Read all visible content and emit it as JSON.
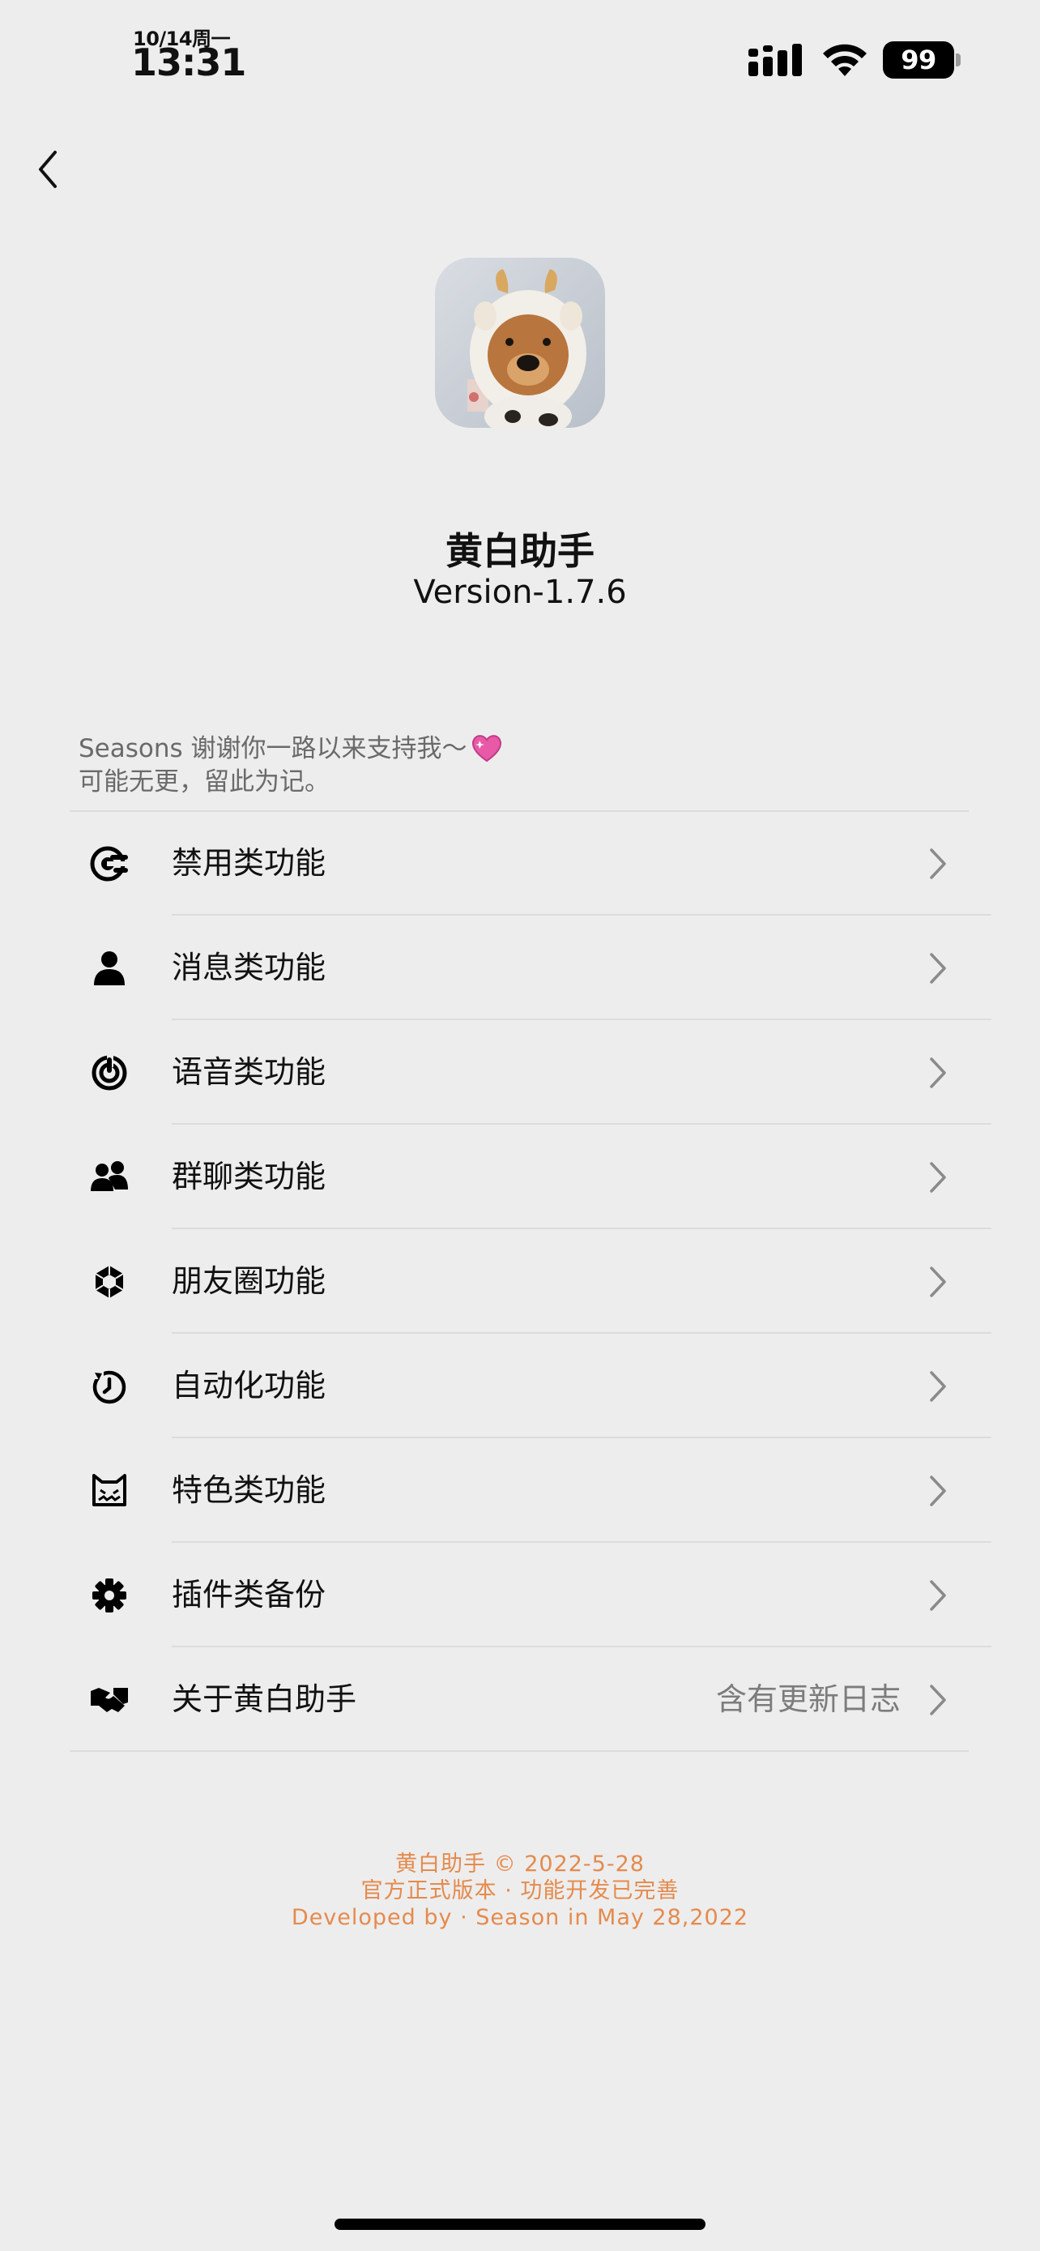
{
  "status_bar": {
    "date": "10/14周一",
    "time": "13:31",
    "battery": "99"
  },
  "header": {
    "app_name": "黄白助手",
    "version": "Version-1.7.6"
  },
  "note": {
    "line1": "Seasons 谢谢你一路以来支持我～",
    "line2": "可能无更，留此为记。"
  },
  "menu": {
    "items": [
      {
        "label": "禁用类功能",
        "icon": "block-icon"
      },
      {
        "label": "消息类功能",
        "icon": "person-icon"
      },
      {
        "label": "语音类功能",
        "icon": "voice-icon"
      },
      {
        "label": "群聊类功能",
        "icon": "group-icon"
      },
      {
        "label": "朋友圈功能",
        "icon": "moments-icon"
      },
      {
        "label": "自动化功能",
        "icon": "timer-icon"
      },
      {
        "label": "特色类功能",
        "icon": "cat-icon"
      },
      {
        "label": "插件类备份",
        "icon": "gear-icon"
      },
      {
        "label": "关于黄白助手",
        "value": "含有更新日志",
        "icon": "handshake-icon"
      }
    ]
  },
  "footer": {
    "line1": "黄白助手 © 2022-5-28",
    "line2": "官方正式版本 · 功能开发已完善",
    "line3": "Developed by · Season in May 28,2022"
  },
  "colors": {
    "background": "#ededed",
    "footer_accent": "#e58a4d",
    "secondary_text": "#7c7c7c"
  }
}
